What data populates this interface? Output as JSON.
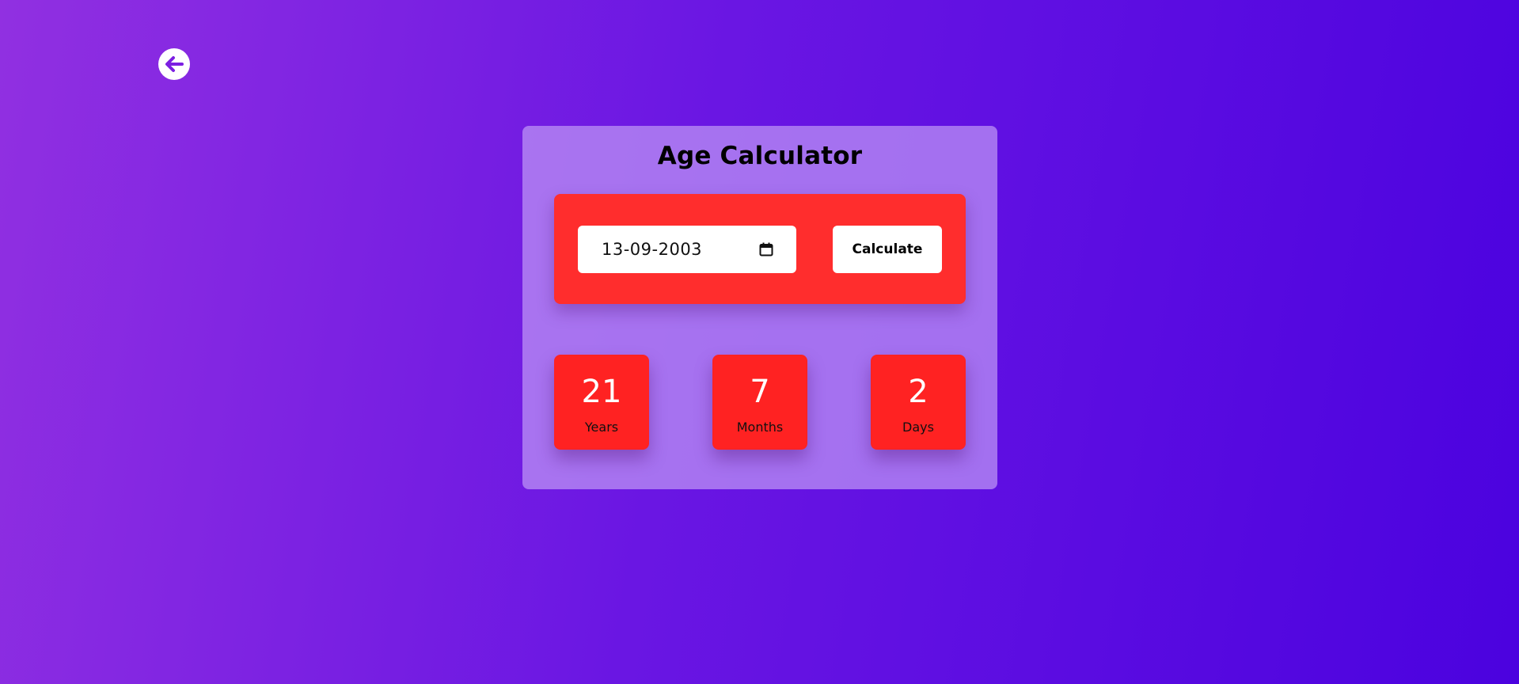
{
  "header": {
    "back_icon": "arrow-left-circle-icon"
  },
  "calculator": {
    "title": "Age Calculator",
    "date_input": {
      "value": "13-09-2003",
      "icon": "calendar-icon"
    },
    "calculate_label": "Calculate",
    "results": [
      {
        "value": "21",
        "label": "Years"
      },
      {
        "value": "7",
        "label": "Months"
      },
      {
        "value": "2",
        "label": "Days"
      }
    ]
  },
  "colors": {
    "background_start": "#9130e1",
    "background_end": "#4b02df",
    "panel_red": "#ff2d2d",
    "box_red": "#ff2222",
    "card": "#be96f5",
    "icon_purple": "#7c1fe2"
  }
}
